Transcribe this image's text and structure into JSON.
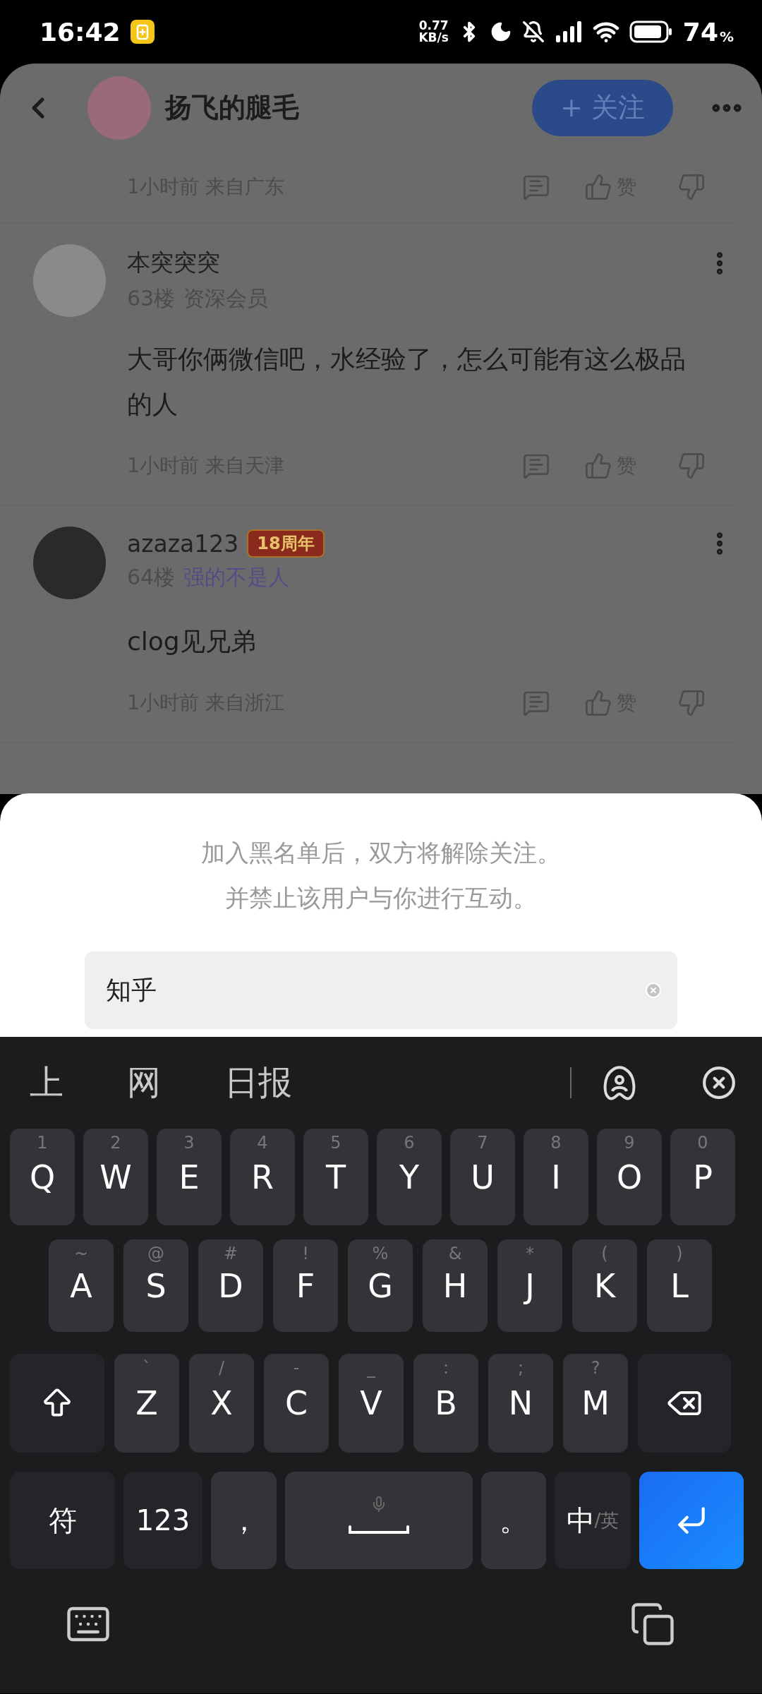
{
  "status_bar": {
    "time": "16:42",
    "speed_value": "0.77",
    "speed_unit": "KB/s",
    "battery_percent": "74",
    "battery_unit": "%"
  },
  "header": {
    "title": "扬飞的腿毛",
    "follow_button": "+ 关注"
  },
  "top_meta": {
    "meta": "1小时前 来自广东",
    "like_label": "赞"
  },
  "comments": [
    {
      "name": "本突突突",
      "floor": "63楼",
      "title": "资深会员",
      "highlighted": false,
      "text": "大哥你俩微信吧，水经验了，怎么可能有这么极品的人",
      "meta": "1小时前 来自天津",
      "like_label": "赞"
    },
    {
      "name": "azaza123",
      "badge": "18周年",
      "floor": "64楼",
      "title": "强的不是人",
      "highlighted": true,
      "text": "clog见兄弟",
      "meta": "1小时前 来自浙江",
      "like_label": "赞"
    }
  ],
  "sheet": {
    "message_lines": [
      "加入黑名单后，双方将解除关注。",
      "并禁止该用户与你进行互动。"
    ],
    "input_value": "知乎"
  },
  "keyboard": {
    "candidates": [
      "上",
      "网",
      "日报"
    ],
    "rows": [
      {
        "keys": [
          {
            "kind": "letter",
            "label": "Q",
            "hint": "1"
          },
          {
            "kind": "letter",
            "label": "W",
            "hint": "2"
          },
          {
            "kind": "letter",
            "label": "E",
            "hint": "3"
          },
          {
            "kind": "letter",
            "label": "R",
            "hint": "4"
          },
          {
            "kind": "letter",
            "label": "T",
            "hint": "5"
          },
          {
            "kind": "letter",
            "label": "Y",
            "hint": "6"
          },
          {
            "kind": "letter",
            "label": "U",
            "hint": "7"
          },
          {
            "kind": "letter",
            "label": "I",
            "hint": "8"
          },
          {
            "kind": "letter",
            "label": "O",
            "hint": "9"
          },
          {
            "kind": "letter",
            "label": "P",
            "hint": "0"
          }
        ]
      },
      {
        "keys": [
          {
            "kind": "letter",
            "label": "A",
            "hint": "~"
          },
          {
            "kind": "letter",
            "label": "S",
            "hint": "@"
          },
          {
            "kind": "letter",
            "label": "D",
            "hint": "#"
          },
          {
            "kind": "letter",
            "label": "F",
            "hint": "!"
          },
          {
            "kind": "letter",
            "label": "G",
            "hint": "%"
          },
          {
            "kind": "letter",
            "label": "H",
            "hint": "&"
          },
          {
            "kind": "letter",
            "label": "J",
            "hint": "*"
          },
          {
            "kind": "letter",
            "label": "K",
            "hint": "("
          },
          {
            "kind": "letter",
            "label": "L",
            "hint": ")"
          }
        ]
      },
      {
        "keys": [
          {
            "kind": "shift"
          },
          {
            "kind": "letter",
            "label": "Z",
            "hint": "`"
          },
          {
            "kind": "letter",
            "label": "X",
            "hint": "/"
          },
          {
            "kind": "letter",
            "label": "C",
            "hint": "-"
          },
          {
            "kind": "letter",
            "label": "V",
            "hint": "_"
          },
          {
            "kind": "letter",
            "label": "B",
            "hint": ":"
          },
          {
            "kind": "letter",
            "label": "N",
            "hint": ";"
          },
          {
            "kind": "letter",
            "label": "M",
            "hint": "?"
          },
          {
            "kind": "backspace"
          }
        ]
      },
      {
        "keys": [
          {
            "kind": "function",
            "label": "符"
          },
          {
            "kind": "function",
            "label": "123"
          },
          {
            "kind": "punct",
            "label": "，"
          },
          {
            "kind": "space"
          },
          {
            "kind": "punct",
            "label": "。"
          },
          {
            "kind": "lang",
            "label": "中",
            "hint": "/英"
          },
          {
            "kind": "enter"
          }
        ]
      }
    ]
  }
}
